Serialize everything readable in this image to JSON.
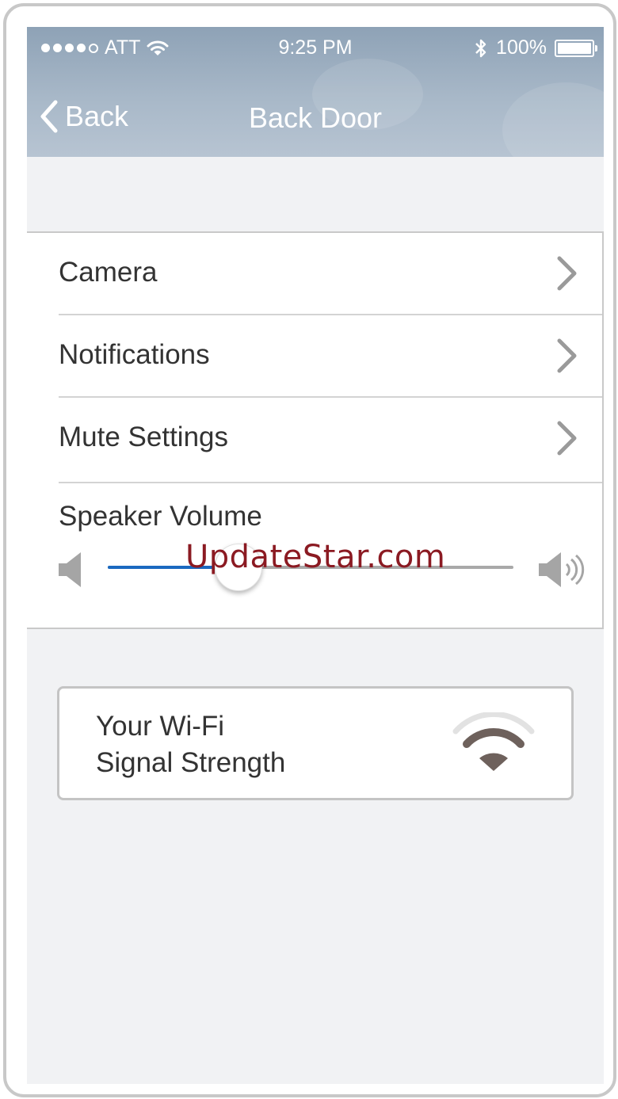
{
  "status_bar": {
    "carrier": "ATT",
    "time": "9:25 PM",
    "battery_percent": "100%",
    "battery_level": 1.0,
    "signal_bars_filled": 4,
    "signal_bars_total": 5
  },
  "nav": {
    "back_label": "Back",
    "title": "Back Door"
  },
  "settings": {
    "items": [
      {
        "label": "Camera"
      },
      {
        "label": "Notifications"
      },
      {
        "label": "Mute Settings"
      }
    ],
    "speaker_volume": {
      "label": "Speaker Volume",
      "value": 0.32
    }
  },
  "wifi_card": {
    "line1": "Your Wi-Fi",
    "line2": "Signal Strength",
    "icon": "wifi-strength-icon",
    "signal_level": "2 of 3"
  },
  "watermark": "UpdateStar.com",
  "colors": {
    "accent": "#1a69c0",
    "header": "#a3b3c4",
    "background": "#f1f2f4",
    "watermark": "#8b1a22"
  }
}
